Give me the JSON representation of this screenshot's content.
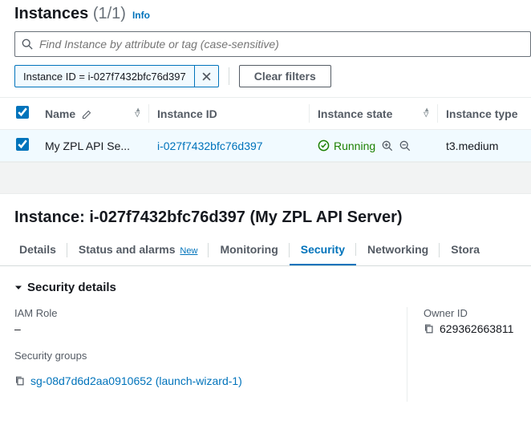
{
  "header": {
    "title": "Instances",
    "count": "(1/1)",
    "info": "Info"
  },
  "search": {
    "placeholder": "Find Instance by attribute or tag (case-sensitive)"
  },
  "filter": {
    "chip": "Instance ID = i-027f7432bfc76d397",
    "clear": "Clear filters"
  },
  "columns": {
    "name": "Name",
    "instance_id": "Instance ID",
    "instance_state": "Instance state",
    "instance_type": "Instance type"
  },
  "row": {
    "name": "My ZPL API Se...",
    "instance_id": "i-027f7432bfc76d397",
    "state": "Running",
    "type": "t3.medium"
  },
  "detail": {
    "title": "Instance: i-027f7432bfc76d397 (My ZPL API Server)"
  },
  "tabs": {
    "details": "Details",
    "status": "Status and alarms",
    "status_new": "New",
    "monitoring": "Monitoring",
    "security": "Security",
    "networking": "Networking",
    "storage": "Stora"
  },
  "security": {
    "section_title": "Security details",
    "iam_label": "IAM Role",
    "iam_value": "–",
    "owner_label": "Owner ID",
    "owner_value": "629362663811",
    "sg_label": "Security groups",
    "sg_value": "sg-08d7d6d2aa0910652 (launch-wizard-1)"
  }
}
